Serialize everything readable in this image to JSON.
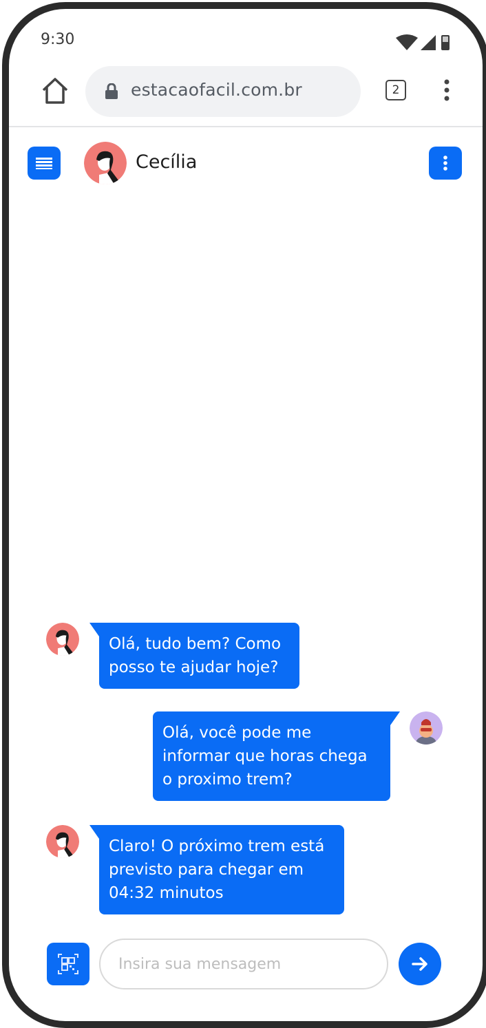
{
  "status": {
    "time": "9:30"
  },
  "browser": {
    "url": "estacaofacil.com.br",
    "tab_count": "2"
  },
  "chat": {
    "contact_name": "Cecília"
  },
  "messages": [
    {
      "sender": "bot",
      "text": "Olá, tudo bem? Como posso te ajudar hoje?"
    },
    {
      "sender": "user",
      "text": "Olá, você pode me informar que horas chega o proximo trem?"
    },
    {
      "sender": "bot",
      "text": "Claro! O próximo trem está previsto para chegar em 04:32 minutos"
    }
  ],
  "composer": {
    "placeholder": "Insira sua mensagem"
  },
  "colors": {
    "accent": "#0a6cf5",
    "bot_avatar_bg": "#f07b76",
    "user_avatar_bg": "#c9b3ef",
    "frame": "#2b2b2b"
  }
}
